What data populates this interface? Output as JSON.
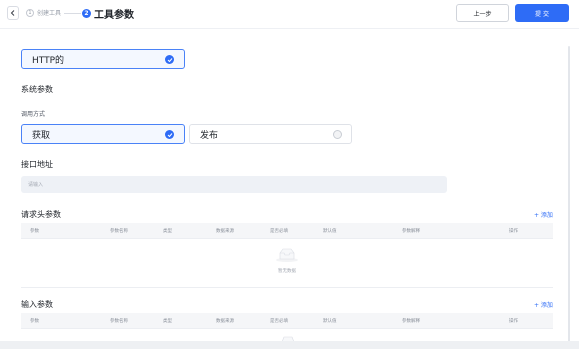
{
  "header": {
    "back_icon": "chevron-left-icon",
    "step1_number": "1",
    "step1_label": "创建工具",
    "step2_number": "2",
    "step2_label": "工具参数",
    "prev_label": "上一步",
    "submit_label": "提 交"
  },
  "protocol": {
    "selected_label": "HTTP的"
  },
  "system_params": {
    "title": "系统参数",
    "call_method_label": "调用方式",
    "options": [
      {
        "label": "获取",
        "selected": true
      },
      {
        "label": "发布",
        "selected": false
      }
    ]
  },
  "endpoint": {
    "label": "接口地址",
    "placeholder": "请输入"
  },
  "request_headers": {
    "title": "请求头参数",
    "add_label": "+ 添加",
    "columns": [
      "参数",
      "参数名称",
      "类型",
      "数据来源",
      "是否必填",
      "默认值",
      "参数解释",
      "操作"
    ],
    "empty_text": "暂无数据"
  },
  "input_params": {
    "title": "输入参数",
    "add_label": "+ 添加",
    "columns": [
      "参数",
      "参数名称",
      "类型",
      "数据来源",
      "是否必填",
      "默认值",
      "参数解释",
      "操作"
    ]
  },
  "colors": {
    "accent": "#2e6cf6",
    "selected_border": "#4a82f7",
    "input_bg": "#eef1f6"
  }
}
